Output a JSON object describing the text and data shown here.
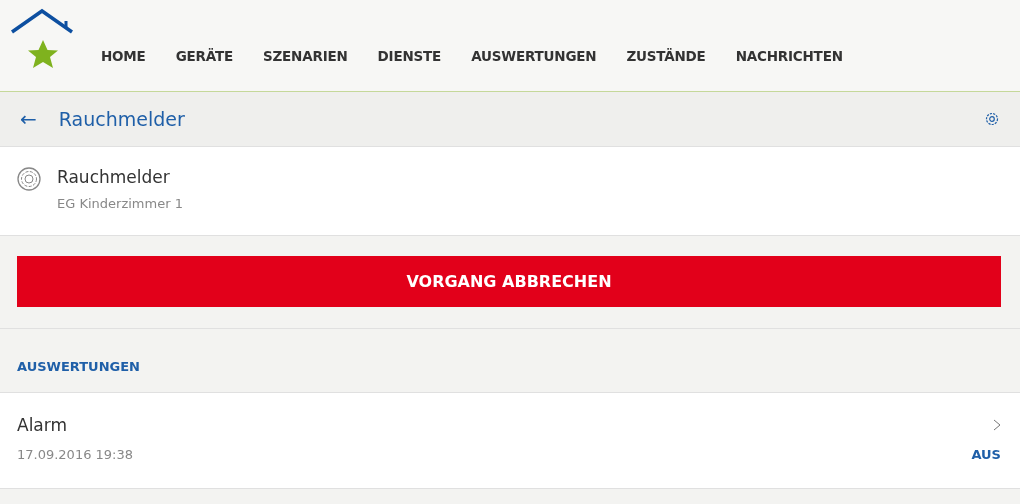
{
  "nav": [
    "HOME",
    "GERÄTE",
    "SZENARIEN",
    "DIENSTE",
    "AUSWERTUNGEN",
    "ZUSTÄNDE",
    "NACHRICHTEN"
  ],
  "title_bar": {
    "back": "←",
    "title": "Rauchmelder"
  },
  "device": {
    "name": "Rauchmelder",
    "room": "EG Kinderzimmer 1"
  },
  "action_button": "VORGANG ABBRECHEN",
  "section_heading": "AUSWERTUNGEN",
  "entries": [
    {
      "name": "Alarm",
      "timestamp": "17.09.2016 19:38",
      "value": "AUS"
    }
  ]
}
